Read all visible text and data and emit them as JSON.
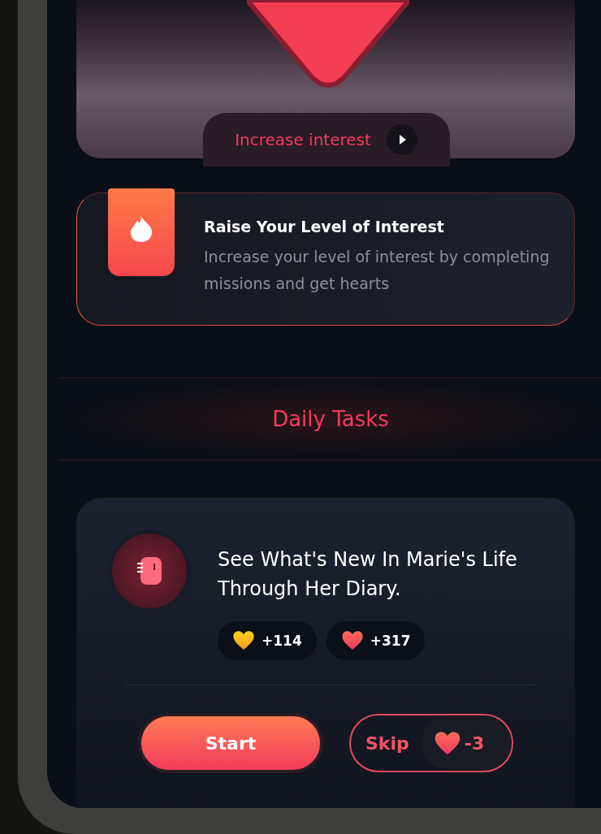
{
  "hero": {
    "button": {
      "label": "Increase interest"
    }
  },
  "info_card": {
    "title": "Raise Your Level of Interest",
    "description": "Increase your level of interest by completing missions and get hearts"
  },
  "section_title": "Daily Tasks",
  "task": {
    "title": "See What's New In Marie's Life Through Her Diary.",
    "rewards": [
      {
        "kind": "gold",
        "amount": "+114"
      },
      {
        "kind": "red",
        "amount": "+317"
      }
    ],
    "start": {
      "label": "Start"
    },
    "skip": {
      "label": "Skip",
      "cost": "-3"
    }
  }
}
